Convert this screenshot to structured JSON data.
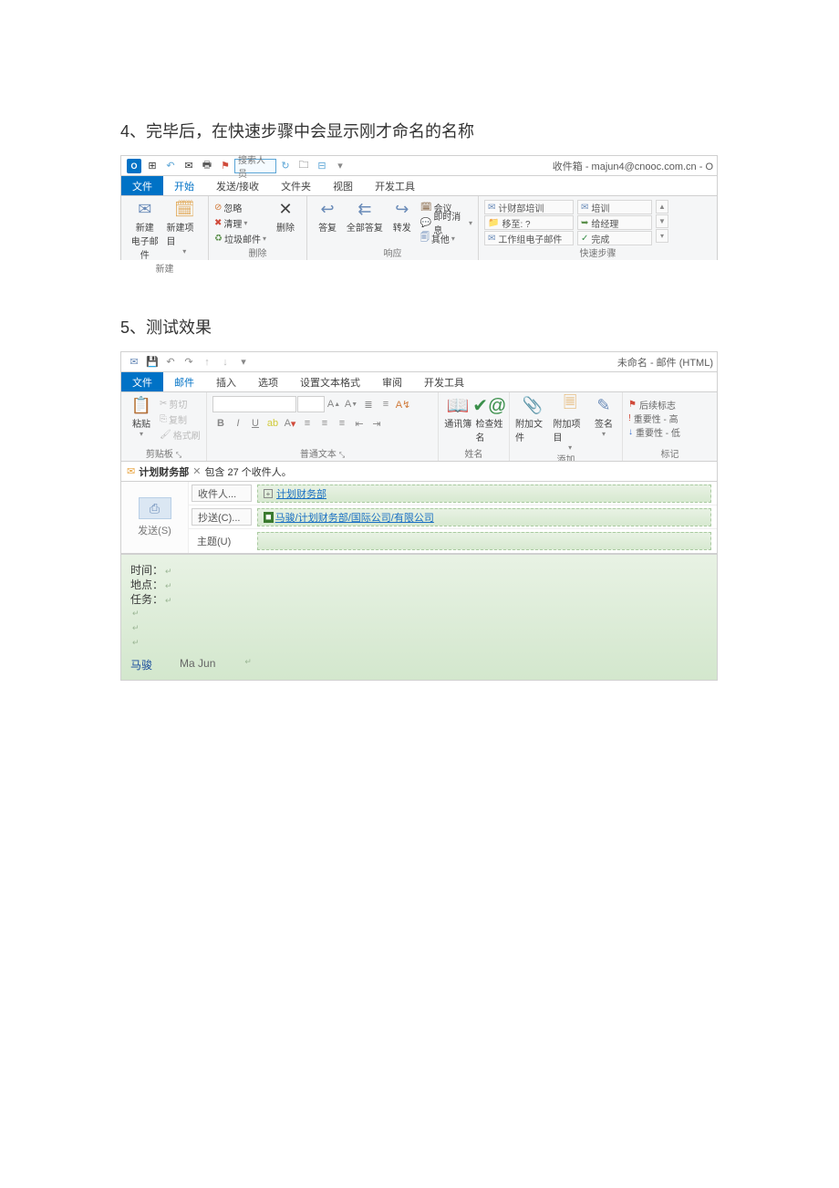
{
  "doc": {
    "heading1": "4、完毕后，在快速步骤中会显示刚才命名的名称",
    "heading2": "5、测试效果"
  },
  "ss1": {
    "qat_search": "搜索人员",
    "title_right": "收件箱 - majun4@cnooc.com.cn - O",
    "tabs": {
      "file": "文件",
      "home": "开始",
      "sendrecv": "发送/接收",
      "folder": "文件夹",
      "view": "视图",
      "dev": "开发工具"
    },
    "new_group": {
      "new_mail": "新建\n电子邮件",
      "new_item": "新建项目",
      "label": "新建"
    },
    "del_group": {
      "ignore": "忽略",
      "cleanup": "清理",
      "junk": "垃圾邮件",
      "delete": "删除",
      "label": "删除"
    },
    "respond": {
      "reply": "答复",
      "replyall": "全部答复",
      "forward": "转发",
      "label": "响应"
    },
    "more": {
      "meeting": "会议",
      "im": "即时消息",
      "other": "其他"
    },
    "quick": {
      "items_left": [
        "计财部培训",
        "移至: ?",
        "工作组电子邮件"
      ],
      "items_right": [
        "培训",
        "给经理",
        "完成"
      ],
      "label": "快速步骤"
    }
  },
  "ss2": {
    "title_right": "未命名 - 邮件 (HTML)",
    "tabs": {
      "file": "文件",
      "mail": "邮件",
      "insert": "插入",
      "options": "选项",
      "format": "设置文本格式",
      "review": "审阅",
      "dev": "开发工具"
    },
    "clip": {
      "cut": "剪切",
      "copy": "复制",
      "painter": "格式刷",
      "paste": "粘贴",
      "label": "剪贴板"
    },
    "basictext": {
      "label": "普通文本"
    },
    "names": {
      "book": "通讯簿",
      "check": "检查姓名",
      "label": "姓名"
    },
    "add": {
      "attachfile": "附加文件",
      "attachitem": "附加项目",
      "sign": "签名",
      "label": "添加"
    },
    "tags": {
      "followup": "后续标志",
      "hi": "重要性 - 高",
      "lo": "重要性 - 低",
      "label": "标记"
    },
    "info": {
      "group": "计划财务部",
      "summary": "包含 27 个收件人。"
    },
    "send": "发送(S)",
    "fields": {
      "to_btn": "收件人...",
      "to_val_link": "计划财务部",
      "cc_btn": "抄送(C)...",
      "cc_val": "马骏/计划财务部/国际公司/有限公司",
      "subj_label": "主题(U)"
    },
    "body": {
      "l1": "时间：",
      "l2": "地点：",
      "l3": "任务：",
      "sig_zh": "马骏",
      "sig_en": "Ma Jun"
    }
  }
}
